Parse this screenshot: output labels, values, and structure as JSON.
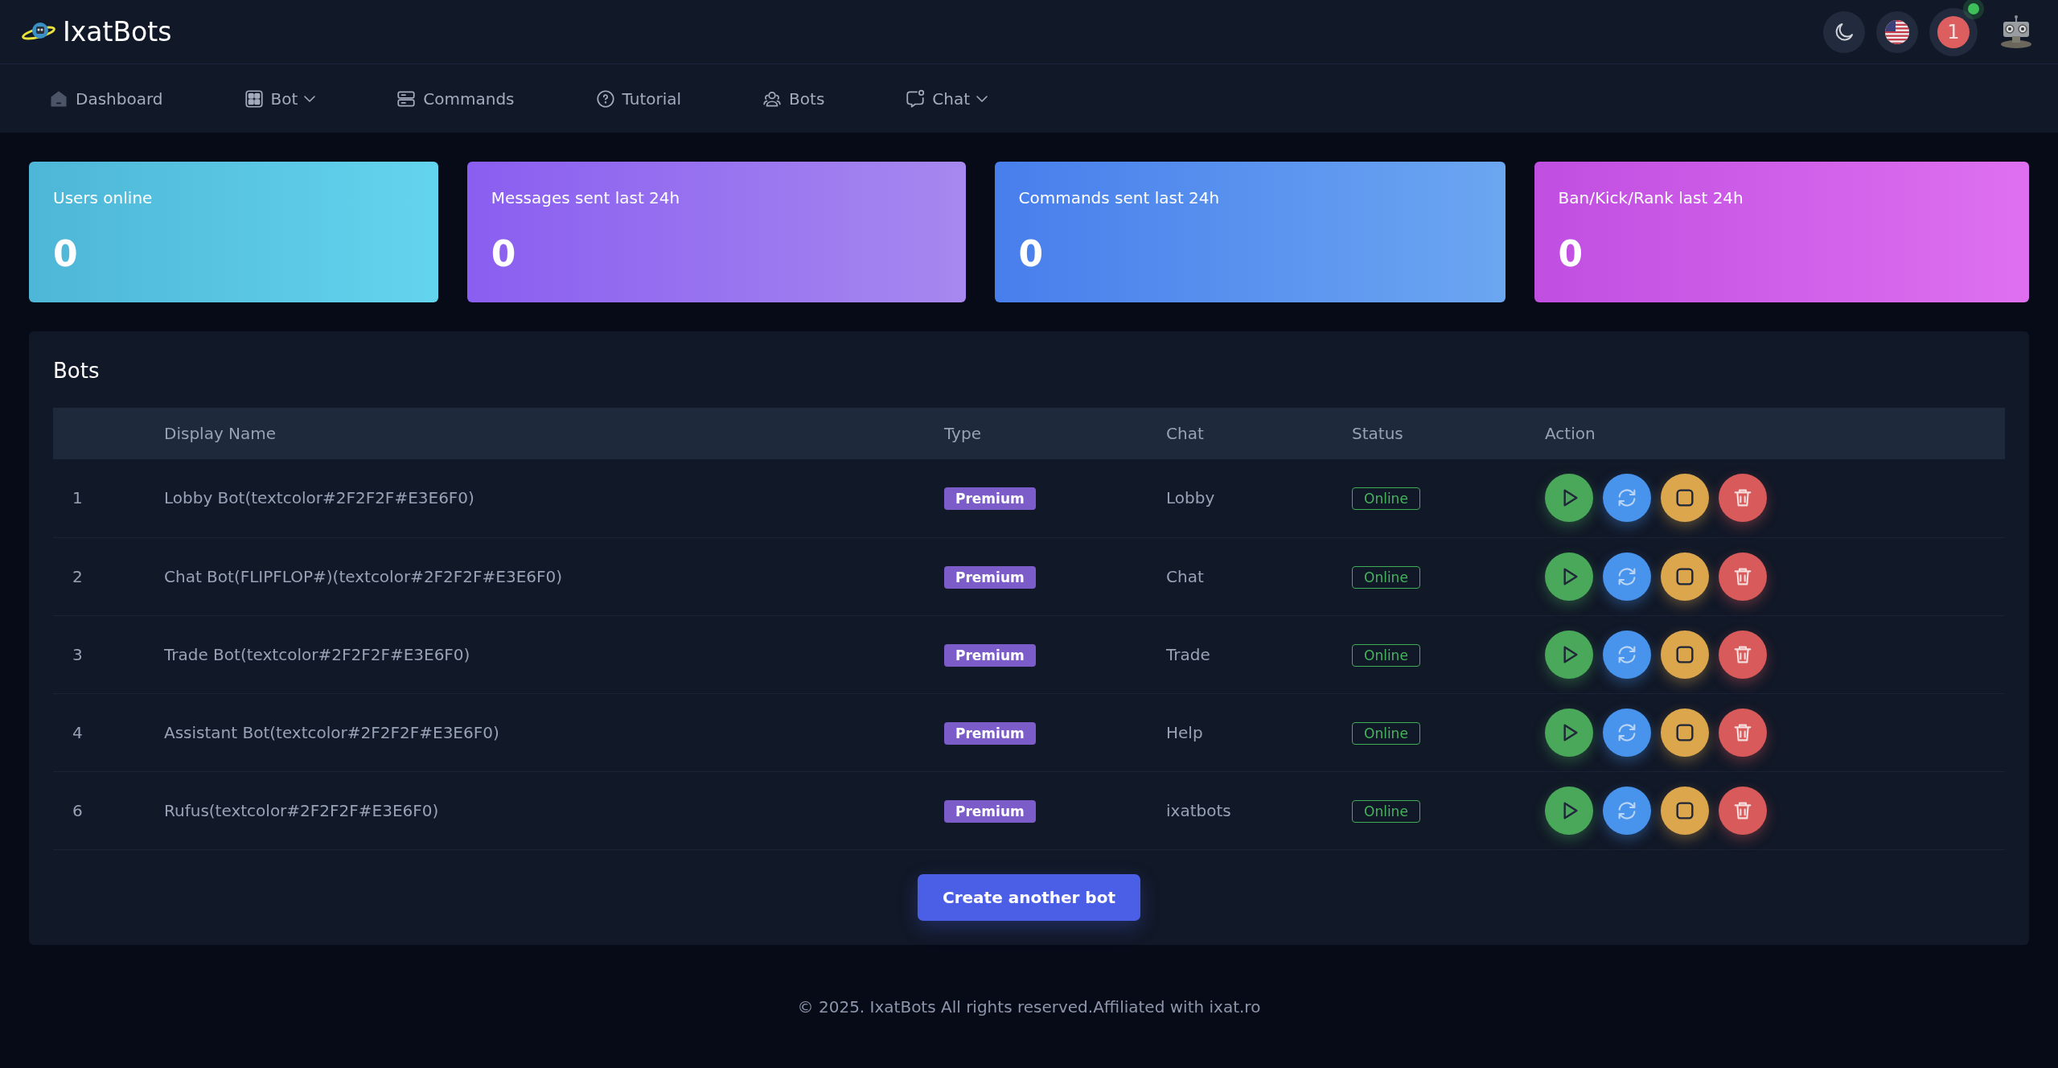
{
  "brand": {
    "name": "IxatBots"
  },
  "header": {
    "notification_count": "1"
  },
  "nav": [
    {
      "label": "Dashboard",
      "dropdown": false
    },
    {
      "label": "Bot",
      "dropdown": true
    },
    {
      "label": "Commands",
      "dropdown": false
    },
    {
      "label": "Tutorial",
      "dropdown": false
    },
    {
      "label": "Bots",
      "dropdown": false
    },
    {
      "label": "Chat",
      "dropdown": true
    }
  ],
  "stats": [
    {
      "label": "Users online",
      "value": "0"
    },
    {
      "label": "Messages sent last 24h",
      "value": "0"
    },
    {
      "label": "Commands sent last 24h",
      "value": "0"
    },
    {
      "label": "Ban/Kick/Rank last 24h",
      "value": "0"
    }
  ],
  "bots_panel": {
    "title": "Bots",
    "columns": [
      "Display Name",
      "Type",
      "Chat",
      "Status",
      "Action"
    ],
    "rows": [
      {
        "number": "1",
        "name": "Lobby Bot(textcolor#2F2F2F#E3E6F0)",
        "type": "Premium",
        "chat": "Lobby",
        "status": "Online"
      },
      {
        "number": "2",
        "name": "Chat Bot(FLIPFLOP#)(textcolor#2F2F2F#E3E6F0)",
        "type": "Premium",
        "chat": "Chat",
        "status": "Online"
      },
      {
        "number": "3",
        "name": "Trade Bot(textcolor#2F2F2F#E3E6F0)",
        "type": "Premium",
        "chat": "Trade",
        "status": "Online"
      },
      {
        "number": "4",
        "name": "Assistant Bot(textcolor#2F2F2F#E3E6F0)",
        "type": "Premium",
        "chat": "Help",
        "status": "Online"
      },
      {
        "number": "6",
        "name": "Rufus(textcolor#2F2F2F#E3E6F0)",
        "type": "Premium",
        "chat": "ixatbots",
        "status": "Online"
      }
    ],
    "create_button": "Create another bot"
  },
  "footer": "© 2025. IxatBots All rights reserved.Affiliated with ixat.ro"
}
